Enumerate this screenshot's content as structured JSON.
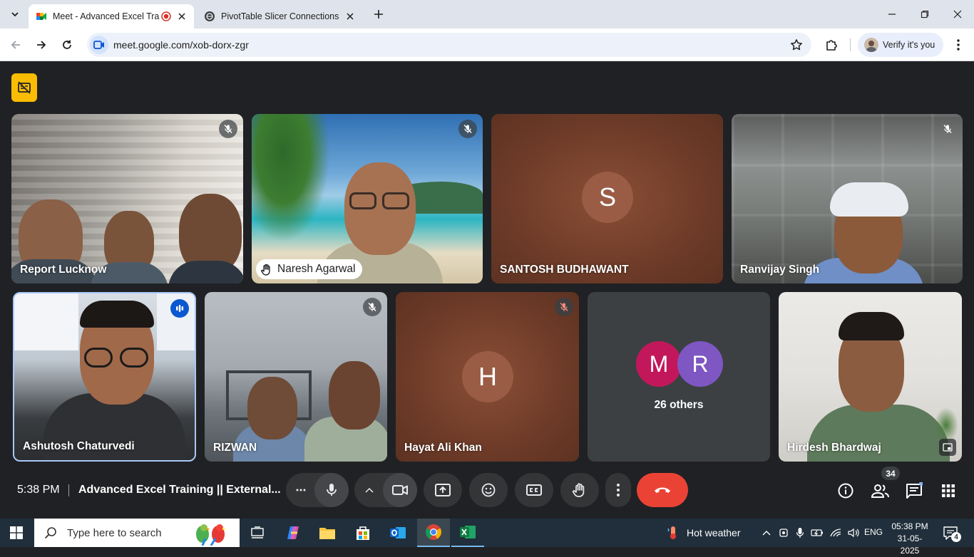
{
  "browser": {
    "tabs": [
      {
        "title": "Meet - Advanced Excel Trai",
        "active": true
      },
      {
        "title": "PivotTable Slicer Connections",
        "active": false
      }
    ],
    "url": "meet.google.com/xob-dorx-zgr",
    "profile_label": "Verify it's you"
  },
  "meet": {
    "tiles": [
      {
        "name": "Report Lucknow"
      },
      {
        "name": "Naresh Agarwal"
      },
      {
        "name": "SANTOSH BUDHAWANT",
        "avatar": "S"
      },
      {
        "name": "Ranvijay Singh"
      },
      {
        "name": "Ashutosh Chaturvedi"
      },
      {
        "name": "RIZWAN"
      },
      {
        "name": "Hayat Ali Khan",
        "avatar": "H"
      },
      {
        "name": "26 others",
        "avatars": [
          "M",
          "R"
        ]
      },
      {
        "name": "Hirdesh Bhardwaj"
      }
    ],
    "bottom_bar": {
      "time": "5:38 PM",
      "meeting_title": "Advanced Excel Training || External...",
      "people_count": "34"
    },
    "colors": {
      "background": "#202124",
      "end_call": "#ea4335",
      "avatar_m": "#c2185b",
      "avatar_r": "#7e57c2",
      "avatar_brown": "#9a5c45",
      "record_badge": "#fbbc04"
    }
  },
  "taskbar": {
    "search_placeholder": "Type here to search",
    "weather": "Hot weather",
    "language": "ENG",
    "time": "05:38 PM",
    "date": "31-05-2025",
    "notification_count": "4"
  }
}
